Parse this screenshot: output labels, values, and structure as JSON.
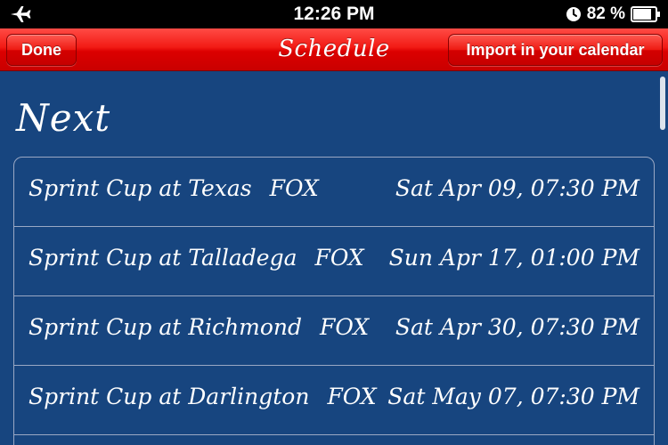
{
  "status_bar": {
    "time": "12:26 PM",
    "battery": "82 %",
    "airplane_icon": "airplane-icon",
    "orientation_lock_icon": "orientation-lock-icon",
    "battery_icon": "battery-icon"
  },
  "nav": {
    "done_label": "Done",
    "title": "Schedule",
    "import_label": "Import in your calendar",
    "bar_color": "#e10b05"
  },
  "section": {
    "title": "Next"
  },
  "races": [
    {
      "name": "Sprint Cup at Texas",
      "channel": "FOX",
      "date": "Sat Apr 09, 07:30 PM"
    },
    {
      "name": "Sprint Cup at Talladega",
      "channel": "FOX",
      "date": "Sun Apr 17, 01:00 PM"
    },
    {
      "name": "Sprint Cup at Richmond",
      "channel": "FOX",
      "date": "Sat Apr 30, 07:30 PM"
    },
    {
      "name": "Sprint Cup at Darlington",
      "channel": "FOX",
      "date": "Sat May 07, 07:30 PM"
    }
  ],
  "colors": {
    "background": "#17457f",
    "separator": "#9aa8c4"
  }
}
